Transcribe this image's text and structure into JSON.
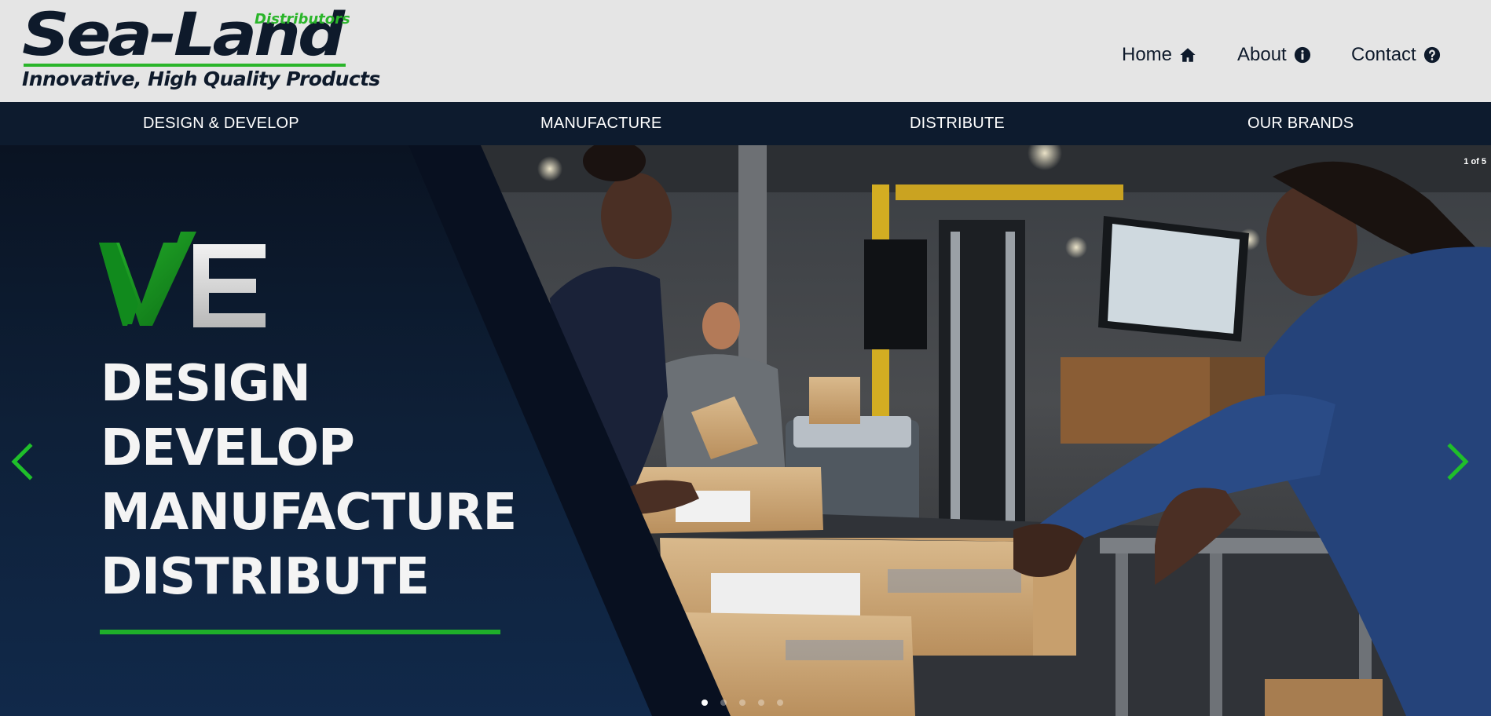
{
  "brand": {
    "name": "Sea-Land",
    "sub": "Distributors",
    "tagline": "Innovative, High Quality Products"
  },
  "topnav": {
    "home": "Home",
    "about": "About",
    "contact": "Contact"
  },
  "menu": {
    "items": [
      "DESIGN & DEVELOP",
      "MANUFACTURE",
      "DISTRIBUTE",
      "OUR BRANDS"
    ]
  },
  "slider": {
    "counter": "1 of 5",
    "slides_total": 5,
    "active_slide": 1,
    "we_text": "WE",
    "headline": [
      "DESIGN",
      "DEVELOP",
      "MANUFACTURE",
      "DISTRIBUTE"
    ]
  },
  "colors": {
    "navy": "#0d1b2e",
    "green": "#1fae2a",
    "header_bg": "#e5e5e5"
  },
  "icons": {
    "home": "house-icon",
    "about": "info-circle-icon",
    "contact": "question-circle-icon",
    "prev": "chevron-left-icon",
    "next": "chevron-right-icon"
  }
}
